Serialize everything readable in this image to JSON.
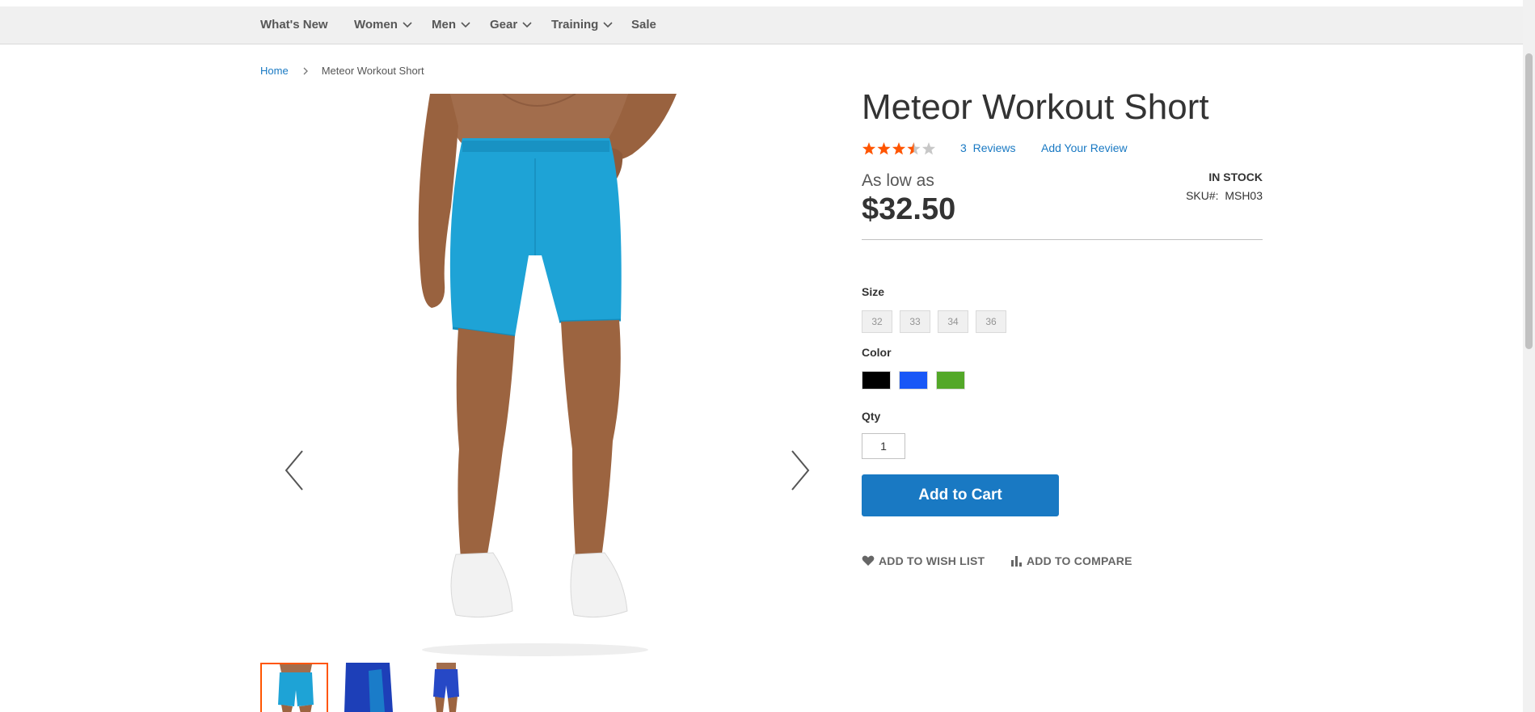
{
  "nav": {
    "items": [
      {
        "label": "What's New",
        "has_dropdown": false
      },
      {
        "label": "Women",
        "has_dropdown": true
      },
      {
        "label": "Men",
        "has_dropdown": true
      },
      {
        "label": "Gear",
        "has_dropdown": true
      },
      {
        "label": "Training",
        "has_dropdown": true
      },
      {
        "label": "Sale",
        "has_dropdown": false
      }
    ]
  },
  "breadcrumb": {
    "home": "Home",
    "separator_icon": "chevron-right-icon",
    "current": "Meteor Workout Short"
  },
  "gallery": {
    "prev_icon": "chevron-left-icon",
    "next_icon": "chevron-right-icon",
    "active_thumb_color": "#ff5501",
    "thumbnails": [
      {
        "name": "thumb-light-blue",
        "color": "#1ea3d6",
        "active": true
      },
      {
        "name": "thumb-navy",
        "color": "#1d3fb8",
        "active": false
      },
      {
        "name": "thumb-blue",
        "color": "#2648c6",
        "active": false
      }
    ]
  },
  "product": {
    "title": "Meteor Workout Short",
    "rating": 3.5,
    "rating_max": 5,
    "reviews_count": "3",
    "reviews_label": "Reviews",
    "add_review_label": "Add Your Review",
    "price_prefix": "As low as",
    "price": "$32.50",
    "stock": "IN STOCK",
    "sku_label": "SKU#:",
    "sku": "MSH03"
  },
  "options": {
    "size_label": "Size",
    "sizes": [
      "32",
      "33",
      "34",
      "36"
    ],
    "color_label": "Color",
    "colors": [
      {
        "name": "Black",
        "hex": "#000000"
      },
      {
        "name": "Blue",
        "hex": "#1857f7"
      },
      {
        "name": "Green",
        "hex": "#53a828"
      }
    ],
    "qty_label": "Qty",
    "qty_value": "1"
  },
  "actions": {
    "add_to_cart": "Add to Cart",
    "wish_list": "Add to Wish List",
    "compare": "Add to Compare"
  },
  "colors": {
    "accent": "#1979c3",
    "star_filled": "#ff5501",
    "star_empty": "#c7c7c7",
    "nav_bg": "#f0f0f0"
  }
}
